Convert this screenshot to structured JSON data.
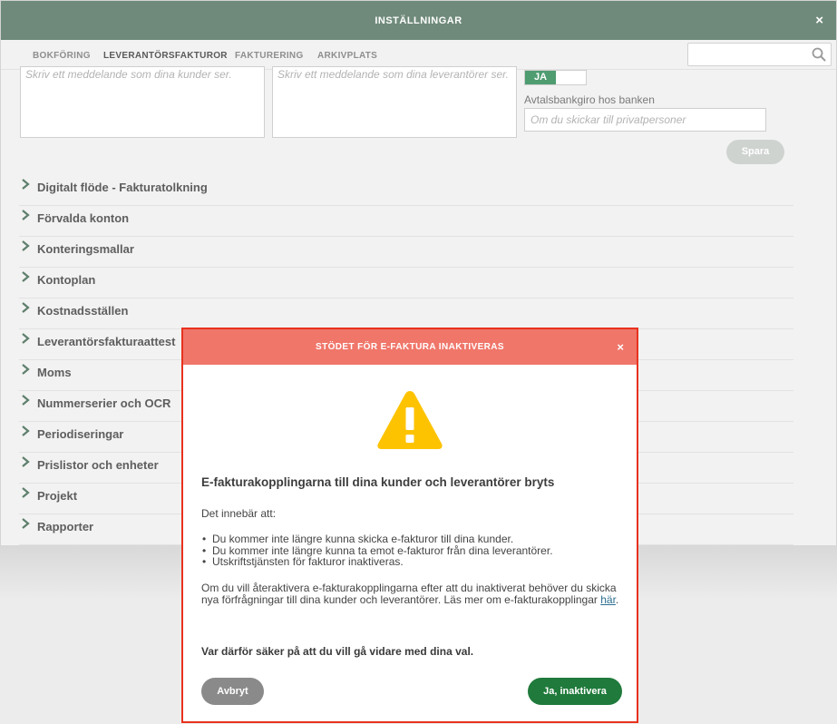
{
  "window": {
    "title": "INSTÄLLNINGAR",
    "close": "×"
  },
  "tabs": [
    {
      "label": "BOKFÖRING"
    },
    {
      "label": "LEVERANTÖRSFAKTUROR"
    },
    {
      "label": "FAKTURERING"
    },
    {
      "label": "ARKIVPLATS"
    }
  ],
  "search": {
    "placeholder": ""
  },
  "form": {
    "customer_message_placeholder": "Skriv ett meddelande som dina kunder ser.",
    "supplier_message_placeholder": "Skriv ett meddelande som dina leverantörer ser.",
    "toggle_label": "JA",
    "bankgiro_label": "Avtalsbankgiro hos banken",
    "bankgiro_placeholder": "Om du skickar till privatpersoner",
    "save_label": "Spara"
  },
  "sections": [
    {
      "label": "Digitalt flöde - Fakturatolkning"
    },
    {
      "label": "Förvalda konton"
    },
    {
      "label": "Konteringsmallar"
    },
    {
      "label": "Kontoplan"
    },
    {
      "label": "Kostnadsställen"
    },
    {
      "label": "Leverantörsfakturaattest"
    },
    {
      "label": "Moms"
    },
    {
      "label": "Nummerserier och OCR"
    },
    {
      "label": "Periodiseringar"
    },
    {
      "label": "Prislistor och enheter"
    },
    {
      "label": "Projekt"
    },
    {
      "label": "Rapporter"
    }
  ],
  "modal": {
    "title": "STÖDET FÖR E-FAKTURA INAKTIVERAS",
    "close": "×",
    "icon": "warning-icon",
    "heading": "E-fakturakopplingarna till dina kunder och leverantörer bryts",
    "intro": "Det innebär att:",
    "bullets": [
      "Du kommer inte längre kunna skicka e-fakturor till dina kunder.",
      "Du kommer inte längre kunna ta emot e-fakturor från dina leverantörer.",
      "Utskriftstjänsten för fakturor inaktiveras."
    ],
    "info_text": "Om du vill återaktivera e-fakturakopplingarna efter att du inaktiverat behöver du skicka nya förfrågningar till dina kunder och leverantörer. Läs mer om e-fakturakopplingar ",
    "info_link": "här",
    "info_end": ".",
    "warning": "Var därför säker på att du vill gå vidare med dina val.",
    "cancel_label": "Avbryt",
    "confirm_label": "Ja, inaktivera"
  },
  "colors": {
    "header_bg": "#6f8a7b",
    "modal_header_bg": "#f0766a",
    "modal_border": "#e8321e",
    "confirm_bg": "#1f7a3b",
    "warning_yellow": "#fdc300"
  }
}
